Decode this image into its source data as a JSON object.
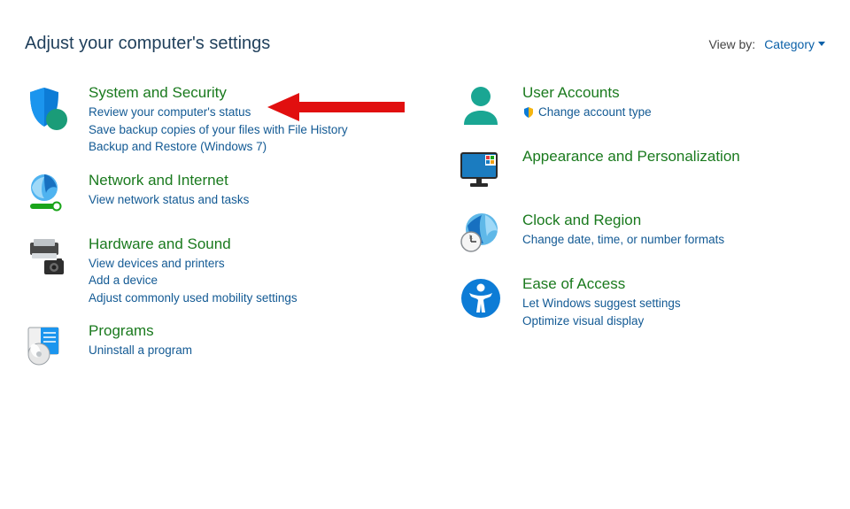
{
  "header": {
    "title": "Adjust your computer's settings",
    "view_by_label": "View by:",
    "view_by_value": "Category"
  },
  "left": {
    "system_security": {
      "title": "System and Security",
      "links": [
        "Review your computer's status",
        "Save backup copies of your files with File History",
        "Backup and Restore (Windows 7)"
      ]
    },
    "network": {
      "title": "Network and Internet",
      "links": [
        "View network status and tasks"
      ]
    },
    "hardware": {
      "title": "Hardware and Sound",
      "links": [
        "View devices and printers",
        "Add a device",
        "Adjust commonly used mobility settings"
      ]
    },
    "programs": {
      "title": "Programs",
      "links": [
        "Uninstall a program"
      ]
    }
  },
  "right": {
    "user_accounts": {
      "title": "User Accounts",
      "links": [
        "Change account type"
      ]
    },
    "appearance": {
      "title": "Appearance and Personalization",
      "links": []
    },
    "clock": {
      "title": "Clock and Region",
      "links": [
        "Change date, time, or number formats"
      ]
    },
    "ease": {
      "title": "Ease of Access",
      "links": [
        "Let Windows suggest settings",
        "Optimize visual display"
      ]
    }
  }
}
